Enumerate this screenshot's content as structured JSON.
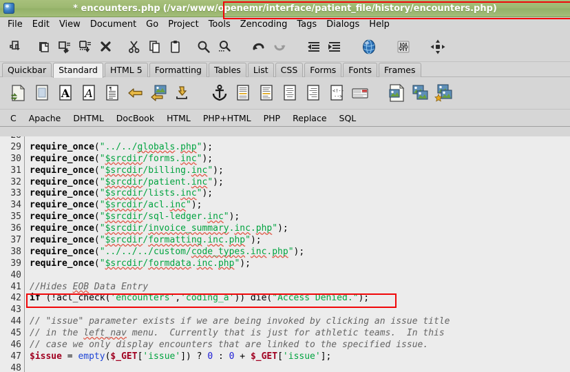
{
  "window": {
    "icon": "app-globe-icon",
    "modified_marker": "*",
    "title": "* encounters.php",
    "path": "(/var/www/openemr/interface/patient_file/history/encounters.php)",
    "bg_color": "#9cb870",
    "annotation_color": "#f00608"
  },
  "menubar": {
    "items": [
      {
        "label": "File"
      },
      {
        "label": "Edit"
      },
      {
        "label": "View"
      },
      {
        "label": "Document"
      },
      {
        "label": "Go"
      },
      {
        "label": "Project"
      },
      {
        "label": "Tools"
      },
      {
        "label": "Zencoding"
      },
      {
        "label": "Tags"
      },
      {
        "label": "Dialogs"
      },
      {
        "label": "Help"
      }
    ]
  },
  "toolbar_main": {
    "items": [
      {
        "name": "new-file-icon",
        "title": "New"
      },
      {
        "sep": true
      },
      {
        "name": "open-file-icon",
        "title": "Open"
      },
      {
        "name": "save-file-icon",
        "title": "Save"
      },
      {
        "name": "save-as-file-icon",
        "title": "Save As"
      },
      {
        "name": "close-file-icon",
        "title": "Close"
      },
      {
        "sep": true
      },
      {
        "name": "cut-icon",
        "title": "Cut"
      },
      {
        "name": "copy-icon",
        "title": "Copy"
      },
      {
        "name": "paste-icon",
        "title": "Paste"
      },
      {
        "sep": true
      },
      {
        "name": "find-icon",
        "title": "Find"
      },
      {
        "name": "find-replace-icon",
        "title": "Find and Replace"
      },
      {
        "sep": true
      },
      {
        "name": "undo-icon",
        "title": "Undo"
      },
      {
        "name": "redo-icon",
        "title": "Redo"
      },
      {
        "sep": true
      },
      {
        "name": "unindent-icon",
        "title": "Unindent"
      },
      {
        "name": "indent-icon",
        "title": "Indent"
      },
      {
        "sep": true
      },
      {
        "name": "browser-preview-icon",
        "title": "Preview in browser"
      },
      {
        "sep": true
      },
      {
        "name": "preferences-icon",
        "title": "Preferences"
      },
      {
        "sep": true
      },
      {
        "name": "fullscreen-icon",
        "title": "Fullscreen"
      }
    ]
  },
  "tabs": {
    "active": "Standard",
    "items": [
      {
        "label": "Quickbar"
      },
      {
        "label": "Standard"
      },
      {
        "label": "HTML 5"
      },
      {
        "label": "Formatting"
      },
      {
        "label": "Tables"
      },
      {
        "label": "List"
      },
      {
        "label": "CSS"
      },
      {
        "label": "Forms"
      },
      {
        "label": "Fonts"
      },
      {
        "label": "Frames"
      }
    ]
  },
  "toolbar_html": {
    "items": [
      {
        "name": "quickstart-doc-icon",
        "title": "Quickstart"
      },
      {
        "name": "body-doc-icon",
        "title": "Body"
      },
      {
        "name": "bold-icon",
        "title": "Bold"
      },
      {
        "name": "italic-icon",
        "title": "Italic"
      },
      {
        "name": "paragraph-icon",
        "title": "Paragraph"
      },
      {
        "name": "linebreak-icon",
        "title": "Break"
      },
      {
        "name": "break-clear-icon",
        "title": "Break and clear"
      },
      {
        "name": "nonbreaking-space-icon",
        "title": "Non-breaking space"
      },
      {
        "sep": true
      },
      {
        "name": "anchor-icon",
        "title": "Anchor"
      },
      {
        "name": "rule-icon",
        "title": "Horizontal rule"
      },
      {
        "name": "align-left-icon",
        "title": "Align left"
      },
      {
        "name": "align-center-icon",
        "title": "Align center"
      },
      {
        "name": "align-right-icon",
        "title": "Align right"
      },
      {
        "name": "comment-icon",
        "title": "Comment"
      },
      {
        "name": "email-icon",
        "title": "Email"
      },
      {
        "sep": true
      },
      {
        "name": "insert-image-icon",
        "title": "Insert image"
      },
      {
        "name": "multi-thumbnail-icon",
        "title": "Multi thumbnail"
      },
      {
        "name": "thumbnail-star-icon",
        "title": "Thumbnail"
      }
    ]
  },
  "langbar": {
    "items": [
      {
        "label": "C"
      },
      {
        "label": "Apache"
      },
      {
        "label": "DHTML"
      },
      {
        "label": "DocBook"
      },
      {
        "label": "HTML"
      },
      {
        "label": "PHP+HTML"
      },
      {
        "label": "PHP"
      },
      {
        "label": "Replace"
      },
      {
        "label": "SQL"
      }
    ]
  },
  "editor": {
    "first_visible_line": 28,
    "highlighted_line": 42,
    "lines": [
      {
        "n": 28,
        "partial": true,
        "tokens": []
      },
      {
        "n": 29,
        "tokens": [
          {
            "t": "require_once",
            "c": "fn"
          },
          {
            "t": "(",
            "c": "pun"
          },
          {
            "t": "\"../../",
            "c": "str"
          },
          {
            "t": "globals",
            "c": "str spell"
          },
          {
            "t": ".",
            "c": "str"
          },
          {
            "t": "php",
            "c": "str spell"
          },
          {
            "t": "\"",
            "c": "str"
          },
          {
            "t": ");",
            "c": "pun"
          }
        ]
      },
      {
        "n": 30,
        "tokens": [
          {
            "t": "require_once",
            "c": "fn"
          },
          {
            "t": "(",
            "c": "pun"
          },
          {
            "t": "\"",
            "c": "str"
          },
          {
            "t": "$srcdir",
            "c": "str spell"
          },
          {
            "t": "/forms.",
            "c": "str"
          },
          {
            "t": "inc",
            "c": "str spell"
          },
          {
            "t": "\"",
            "c": "str"
          },
          {
            "t": ");",
            "c": "pun"
          }
        ]
      },
      {
        "n": 31,
        "tokens": [
          {
            "t": "require_once",
            "c": "fn"
          },
          {
            "t": "(",
            "c": "pun"
          },
          {
            "t": "\"",
            "c": "str"
          },
          {
            "t": "$srcdir",
            "c": "str spell"
          },
          {
            "t": "/billing.",
            "c": "str"
          },
          {
            "t": "inc",
            "c": "str spell"
          },
          {
            "t": "\"",
            "c": "str"
          },
          {
            "t": ");",
            "c": "pun"
          }
        ]
      },
      {
        "n": 32,
        "tokens": [
          {
            "t": "require_once",
            "c": "fn"
          },
          {
            "t": "(",
            "c": "pun"
          },
          {
            "t": "\"",
            "c": "str"
          },
          {
            "t": "$srcdir",
            "c": "str spell"
          },
          {
            "t": "/patient.",
            "c": "str"
          },
          {
            "t": "inc",
            "c": "str spell"
          },
          {
            "t": "\"",
            "c": "str"
          },
          {
            "t": ");",
            "c": "pun"
          }
        ]
      },
      {
        "n": 33,
        "tokens": [
          {
            "t": "require_once",
            "c": "fn"
          },
          {
            "t": "(",
            "c": "pun"
          },
          {
            "t": "\"",
            "c": "str"
          },
          {
            "t": "$srcdir",
            "c": "str spell"
          },
          {
            "t": "/lists.",
            "c": "str"
          },
          {
            "t": "inc",
            "c": "str spell"
          },
          {
            "t": "\"",
            "c": "str"
          },
          {
            "t": ");",
            "c": "pun"
          }
        ]
      },
      {
        "n": 34,
        "tokens": [
          {
            "t": "require_once",
            "c": "fn"
          },
          {
            "t": "(",
            "c": "pun"
          },
          {
            "t": "\"",
            "c": "str"
          },
          {
            "t": "$srcdir",
            "c": "str spell"
          },
          {
            "t": "/acl.",
            "c": "str"
          },
          {
            "t": "inc",
            "c": "str spell"
          },
          {
            "t": "\"",
            "c": "str"
          },
          {
            "t": ");",
            "c": "pun"
          }
        ]
      },
      {
        "n": 35,
        "tokens": [
          {
            "t": "require_once",
            "c": "fn"
          },
          {
            "t": "(",
            "c": "pun"
          },
          {
            "t": "\"",
            "c": "str"
          },
          {
            "t": "$srcdir",
            "c": "str spell"
          },
          {
            "t": "/sql-ledger.",
            "c": "str"
          },
          {
            "t": "inc",
            "c": "str spell"
          },
          {
            "t": "\"",
            "c": "str"
          },
          {
            "t": ");",
            "c": "pun"
          }
        ]
      },
      {
        "n": 36,
        "tokens": [
          {
            "t": "require_once",
            "c": "fn"
          },
          {
            "t": "(",
            "c": "pun"
          },
          {
            "t": "\"",
            "c": "str"
          },
          {
            "t": "$srcdir",
            "c": "str spell"
          },
          {
            "t": "/",
            "c": "str"
          },
          {
            "t": "invoice_summary",
            "c": "str spell"
          },
          {
            "t": ".",
            "c": "str"
          },
          {
            "t": "inc",
            "c": "str spell"
          },
          {
            "t": ".",
            "c": "str"
          },
          {
            "t": "php",
            "c": "str spell"
          },
          {
            "t": "\"",
            "c": "str"
          },
          {
            "t": ");",
            "c": "pun"
          }
        ]
      },
      {
        "n": 37,
        "tokens": [
          {
            "t": "require_once",
            "c": "fn"
          },
          {
            "t": "(",
            "c": "pun"
          },
          {
            "t": "\"",
            "c": "str"
          },
          {
            "t": "$srcdir",
            "c": "str spell"
          },
          {
            "t": "/",
            "c": "str"
          },
          {
            "t": "formatting",
            "c": "str spell"
          },
          {
            "t": ".",
            "c": "str"
          },
          {
            "t": "inc",
            "c": "str spell"
          },
          {
            "t": ".",
            "c": "str"
          },
          {
            "t": "php",
            "c": "str spell"
          },
          {
            "t": "\"",
            "c": "str"
          },
          {
            "t": ");",
            "c": "pun"
          }
        ]
      },
      {
        "n": 38,
        "tokens": [
          {
            "t": "require_once",
            "c": "fn"
          },
          {
            "t": "(",
            "c": "pun"
          },
          {
            "t": "\"../../../custom/",
            "c": "str"
          },
          {
            "t": "code_types",
            "c": "str spell"
          },
          {
            "t": ".",
            "c": "str"
          },
          {
            "t": "inc",
            "c": "str spell"
          },
          {
            "t": ".",
            "c": "str"
          },
          {
            "t": "php",
            "c": "str spell"
          },
          {
            "t": "\"",
            "c": "str"
          },
          {
            "t": ");",
            "c": "pun"
          }
        ]
      },
      {
        "n": 39,
        "tokens": [
          {
            "t": "require_once",
            "c": "fn"
          },
          {
            "t": "(",
            "c": "pun"
          },
          {
            "t": "\"",
            "c": "str"
          },
          {
            "t": "$srcdir",
            "c": "str spell"
          },
          {
            "t": "/",
            "c": "str"
          },
          {
            "t": "formdata",
            "c": "str spell"
          },
          {
            "t": ".",
            "c": "str"
          },
          {
            "t": "inc",
            "c": "str spell"
          },
          {
            "t": ".",
            "c": "str"
          },
          {
            "t": "php",
            "c": "str spell"
          },
          {
            "t": "\"",
            "c": "str"
          },
          {
            "t": ");",
            "c": "pun"
          }
        ]
      },
      {
        "n": 40,
        "tokens": []
      },
      {
        "n": 41,
        "tokens": [
          {
            "t": "//Hides ",
            "c": "cmt"
          },
          {
            "t": "EOB",
            "c": "cmt spell"
          },
          {
            "t": " Data Entry",
            "c": "cmt"
          }
        ]
      },
      {
        "n": 42,
        "tokens": [
          {
            "t": "if",
            "c": "kw"
          },
          {
            "t": " (!",
            "c": "pun"
          },
          {
            "t": "acl_check",
            "c": "fnb"
          },
          {
            "t": "(",
            "c": "pun"
          },
          {
            "t": "'encounters'",
            "c": "str"
          },
          {
            "t": ",",
            "c": "pun"
          },
          {
            "t": "'coding_a'",
            "c": "str"
          },
          {
            "t": "))",
            "c": "pun"
          },
          {
            "t": " die",
            "c": "pun"
          },
          {
            "t": "(",
            "c": "pun"
          },
          {
            "t": "\"Access Denied.\"",
            "c": "str"
          },
          {
            "t": ");",
            "c": "pun"
          }
        ]
      },
      {
        "n": 43,
        "tokens": []
      },
      {
        "n": 44,
        "tokens": [
          {
            "t": "// \"issue\" parameter exists if we are being invoked by clicking an issue title",
            "c": "cmt"
          }
        ]
      },
      {
        "n": 45,
        "tokens": [
          {
            "t": "// in the ",
            "c": "cmt"
          },
          {
            "t": "left_nav",
            "c": "cmt spell"
          },
          {
            "t": " menu.  Currently that is just for athletic teams.  In this",
            "c": "cmt"
          }
        ]
      },
      {
        "n": 46,
        "tokens": [
          {
            "t": "// case we only display encounters that are linked to the specified issue.",
            "c": "cmt"
          }
        ]
      },
      {
        "n": 47,
        "tokens": [
          {
            "t": "$issue",
            "c": "var"
          },
          {
            "t": " = ",
            "c": "pun"
          },
          {
            "t": "empty",
            "c": "blu"
          },
          {
            "t": "(",
            "c": "pun"
          },
          {
            "t": "$_GET",
            "c": "var"
          },
          {
            "t": "[",
            "c": "pun"
          },
          {
            "t": "'issue'",
            "c": "str"
          },
          {
            "t": "])",
            "c": "pun"
          },
          {
            "t": " ? ",
            "c": "pun"
          },
          {
            "t": "0",
            "c": "num"
          },
          {
            "t": " : ",
            "c": "pun"
          },
          {
            "t": "0",
            "c": "num"
          },
          {
            "t": " + ",
            "c": "pun"
          },
          {
            "t": "$_GET",
            "c": "var"
          },
          {
            "t": "[",
            "c": "pun"
          },
          {
            "t": "'issue'",
            "c": "str"
          },
          {
            "t": "];",
            "c": "pun"
          }
        ]
      },
      {
        "n": 48,
        "partial": true,
        "tokens": []
      }
    ]
  }
}
